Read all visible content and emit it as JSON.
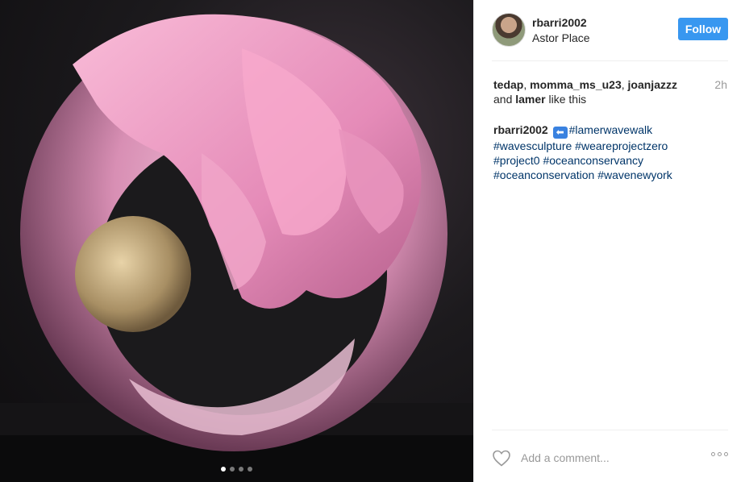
{
  "post": {
    "media": {
      "image_description": "pink wave sculpture with pearl",
      "carousel_dots": 4,
      "active_dot_index": 0
    },
    "header": {
      "username": "rbarri2002",
      "location": "Astor Place",
      "follow_label": "Follow"
    },
    "likes": {
      "users": [
        "tedap",
        "momma_ms_u23",
        "joanjazzz"
      ],
      "last_user": "lamer",
      "and_text": "and",
      "suffix": "like this",
      "timestamp": "2h"
    },
    "caption": {
      "author": "rbarri2002",
      "emoji": "⬅️",
      "hashtags": [
        "#lamerwavewalk",
        "#wavesculpture",
        "#weareprojectzero",
        "#project0",
        "#oceanconservancy",
        "#oceanconservation",
        "#wavenewyork"
      ]
    },
    "comment": {
      "placeholder": "Add a comment..."
    }
  },
  "colors": {
    "accent": "#3897f0",
    "hashtag": "#003569",
    "muted": "#999999"
  },
  "icons": {
    "like": "heart-icon",
    "more": "more-options-icon",
    "emoji": "left-arrow-emoji"
  }
}
